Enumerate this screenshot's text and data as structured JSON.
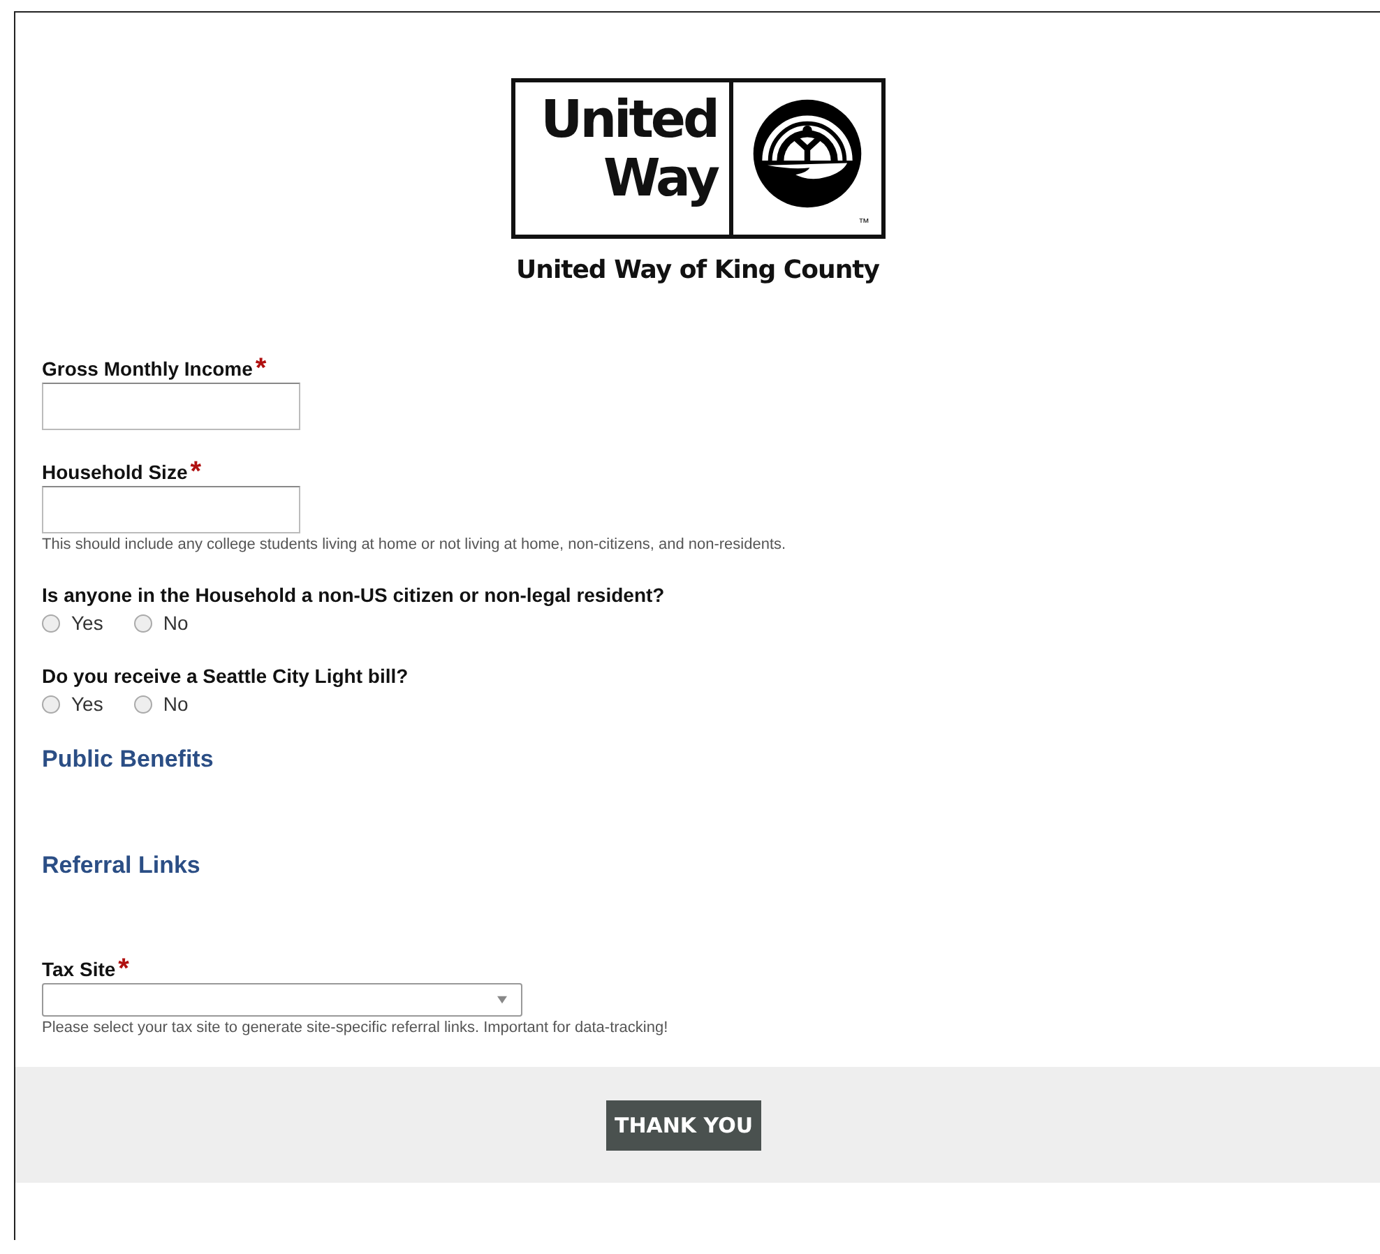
{
  "logo": {
    "wordmark_line_1": "United",
    "wordmark_line_2": "Way",
    "trademark": "™",
    "caption": "United Way of King County"
  },
  "fields": [
    {
      "kind": "text",
      "label": "Gross Monthly Income",
      "required_mark": "*"
    },
    {
      "kind": "text",
      "label": "Household Size",
      "required_mark": "*",
      "help": "This should include any college students living at home or not living at home, non-citizens, and non-residents."
    },
    {
      "kind": "radio",
      "label": "Is anyone in the Household a non-US citizen or non-legal resident?",
      "options": [
        {
          "label": "Yes",
          "selected": false
        },
        {
          "label": "No",
          "selected": false
        }
      ]
    },
    {
      "kind": "radio",
      "label": "Do you receive a Seattle City Light bill?",
      "options": [
        {
          "label": "Yes",
          "selected": false
        },
        {
          "label": "No",
          "selected": false
        }
      ]
    },
    {
      "kind": "heading",
      "label": "Public Benefits"
    },
    {
      "kind": "heading",
      "label": "Referral Links"
    },
    {
      "kind": "select",
      "label": "Tax Site",
      "required_mark": "*",
      "help": "Please select your tax site to generate site-specific referral links. Important for data-tracking!"
    }
  ],
  "submit_button": "THANK YOU"
}
